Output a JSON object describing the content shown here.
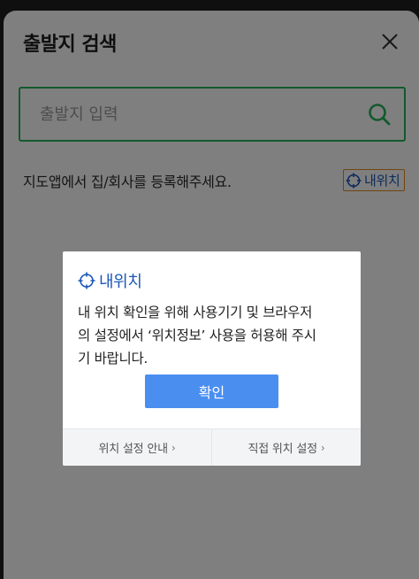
{
  "header": {
    "title": "출발지 검색",
    "close_icon": "close-icon"
  },
  "search": {
    "placeholder": "출발지 입력",
    "value": "",
    "icon": "search-icon",
    "accent_color": "#27b35a"
  },
  "hint": {
    "text": "지도앱에서 집/회사를 등록해주세요.",
    "my_location_label": "내위치",
    "my_location_icon": "crosshair-icon",
    "my_location_border_color": "#e08a1e"
  },
  "dialog": {
    "title": "내위치",
    "title_icon": "crosshair-icon",
    "body": "내 위치 확인을 위해 사용기기 및 브라우저\n의 설정에서 ‘위치정보’ 사용을 허용해 주시\n기 바랍니다.",
    "confirm_label": "확인",
    "confirm_color": "#4a8ff0",
    "footer": {
      "left_label": "위치 설정 안내",
      "right_label": "직접 위치 설정",
      "chevron": "›"
    }
  }
}
